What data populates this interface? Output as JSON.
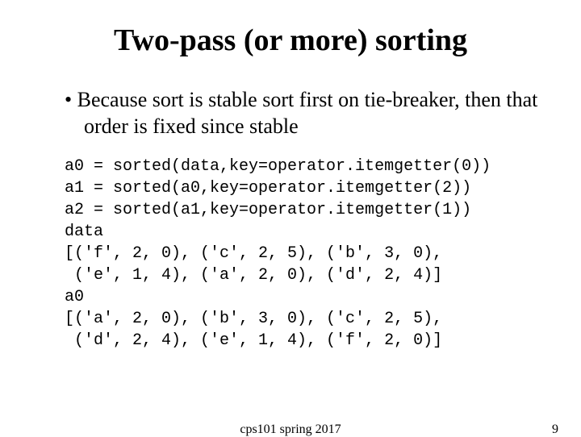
{
  "title": "Two-pass (or more) sorting",
  "bullet": "Because sort is stable sort first on tie-breaker, then that order is fixed since stable",
  "code": "a0 = sorted(data,key=operator.itemgetter(0))\na1 = sorted(a0,key=operator.itemgetter(2))\na2 = sorted(a1,key=operator.itemgetter(1))\ndata\n[('f', 2, 0), ('c', 2, 5), ('b', 3, 0),\n ('e', 1, 4), ('a', 2, 0), ('d', 2, 4)]\na0\n[('a', 2, 0), ('b', 3, 0), ('c', 2, 5),\n ('d', 2, 4), ('e', 1, 4), ('f', 2, 0)]",
  "footer_center": "cps101 spring 2017",
  "footer_right": "9"
}
